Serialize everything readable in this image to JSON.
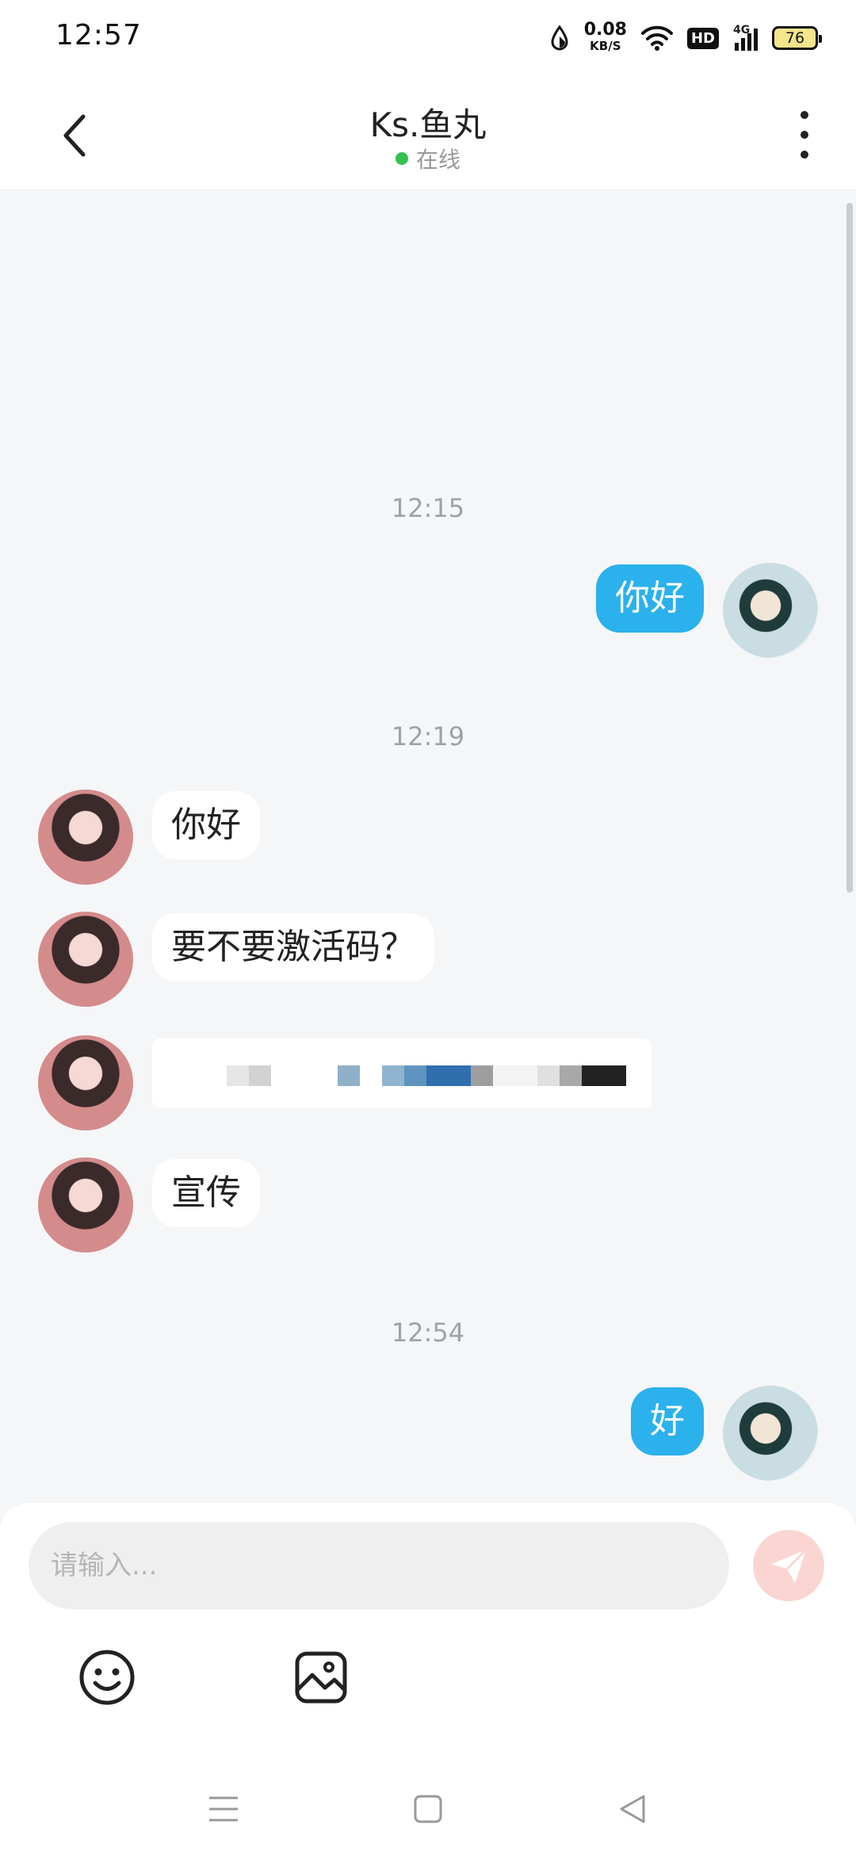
{
  "status_bar": {
    "time": "12:57",
    "net_speed": "0.08",
    "net_speed_unit": "KB/S",
    "hd_label": "HD",
    "network_type": "4G",
    "battery": "76"
  },
  "header": {
    "title": "Ks.鱼丸",
    "status": "在线"
  },
  "messages": [
    {
      "type": "time",
      "text": "12:15"
    },
    {
      "type": "out",
      "text": "你好"
    },
    {
      "type": "time",
      "text": "12:19"
    },
    {
      "type": "in",
      "text": "你好"
    },
    {
      "type": "in",
      "text": "要不要激活码？"
    },
    {
      "type": "in",
      "text": ""
    },
    {
      "type": "in",
      "text": "宣传"
    },
    {
      "type": "time",
      "text": "12:54"
    },
    {
      "type": "out",
      "text": "好"
    }
  ],
  "composer": {
    "placeholder": "请输入..."
  },
  "colors": {
    "outgoing_bubble": "#2bb1ec",
    "online_dot": "#33c24d",
    "send_button": "#f07068"
  }
}
